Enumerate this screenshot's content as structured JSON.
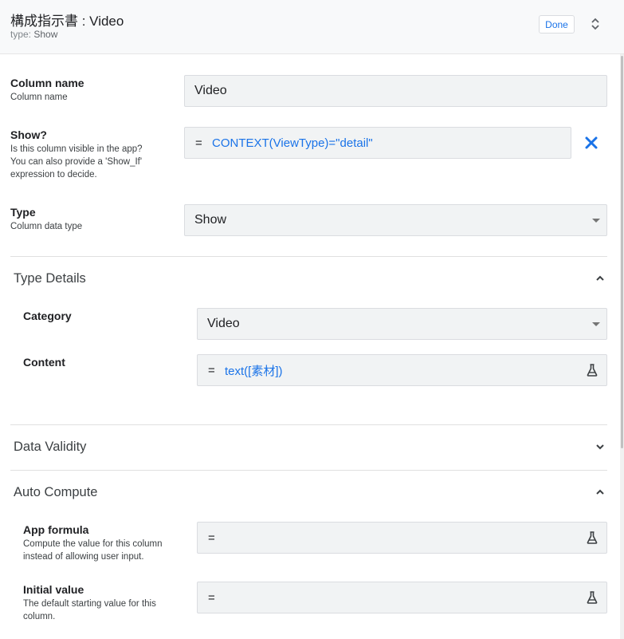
{
  "header": {
    "title": "構成指示書 : Video",
    "type_prefix": "type:",
    "type_value": "Show",
    "done_label": "Done"
  },
  "fields": {
    "column_name": {
      "label": "Column name",
      "description": "Column name",
      "value": "Video"
    },
    "show": {
      "label": "Show?",
      "description_lines": [
        "Is this column visible in the app?",
        "You can also provide a 'Show_If'",
        "expression to decide."
      ],
      "eq": "=",
      "expression": "CONTEXT(ViewType)=\"detail\""
    },
    "type": {
      "label": "Type",
      "description": "Column data type",
      "value": "Show"
    }
  },
  "type_details": {
    "title": "Type Details",
    "category": {
      "label": "Category",
      "value": "Video"
    },
    "content": {
      "label": "Content",
      "eq": "=",
      "expression": "text([素材])"
    }
  },
  "data_validity": {
    "title": "Data Validity"
  },
  "auto_compute": {
    "title": "Auto Compute",
    "app_formula": {
      "label": "App formula",
      "description_lines": [
        "Compute the value for this column",
        "instead of allowing user input."
      ],
      "eq": "="
    },
    "initial_value": {
      "label": "Initial value",
      "description_lines": [
        "The default starting value for this",
        "column."
      ],
      "eq": "="
    }
  },
  "icons": {
    "expand": "expand-collapse-icon",
    "clear": "close-icon",
    "test": "flask-icon",
    "section_open": "chevron-up-icon",
    "section_closed": "chevron-down-icon"
  },
  "colors": {
    "accent": "#1a73e8",
    "field_bg": "#f1f3f4",
    "header_bg": "#f8f9fa"
  }
}
